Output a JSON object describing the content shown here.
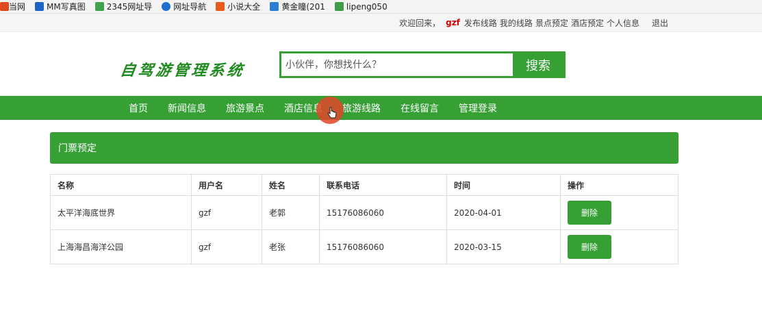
{
  "bookmarks": [
    {
      "label": "当网",
      "color": "#e04b1c"
    },
    {
      "label": "MM写真图",
      "color": "#1e64c8"
    },
    {
      "label": "2345网址导",
      "color": "#3fa34d"
    },
    {
      "label": "网址导航",
      "color": "#1f6fd1"
    },
    {
      "label": "小说大全",
      "color": "#e85a1e"
    },
    {
      "label": "黄金瞳(201",
      "color": "#2a7fd0"
    },
    {
      "label": "lipeng050",
      "color": "#3f9d4a"
    }
  ],
  "topbar": {
    "welcome": "欢迎回来，",
    "username": "gzf",
    "links": [
      "发布线路",
      "我的线路",
      "景点预定",
      "酒店预定",
      "个人信息"
    ],
    "logout": "退出"
  },
  "header": {
    "logo": "自驾游管理系统",
    "search_placeholder": "小伙伴，你想找什么？",
    "search_button": "搜索"
  },
  "nav": [
    "首页",
    "新闻信息",
    "旅游景点",
    "酒店信息",
    "旅游线路",
    "在线留言",
    "管理登录"
  ],
  "panel": {
    "title": "门票预定"
  },
  "table": {
    "headers": [
      "名称",
      "用户名",
      "姓名",
      "联系电话",
      "时间",
      "操作"
    ],
    "rows": [
      {
        "name": "太平洋海底世界",
        "user": "gzf",
        "realname": "老郭",
        "phone": "15176086060",
        "date": "2020-04-01",
        "action": "删除"
      },
      {
        "name": "上海海昌海洋公园",
        "user": "gzf",
        "realname": "老张",
        "phone": "15176086060",
        "date": "2020-03-15",
        "action": "删除"
      }
    ]
  },
  "colors": {
    "brand": "#36a035",
    "username": "#d40000"
  }
}
